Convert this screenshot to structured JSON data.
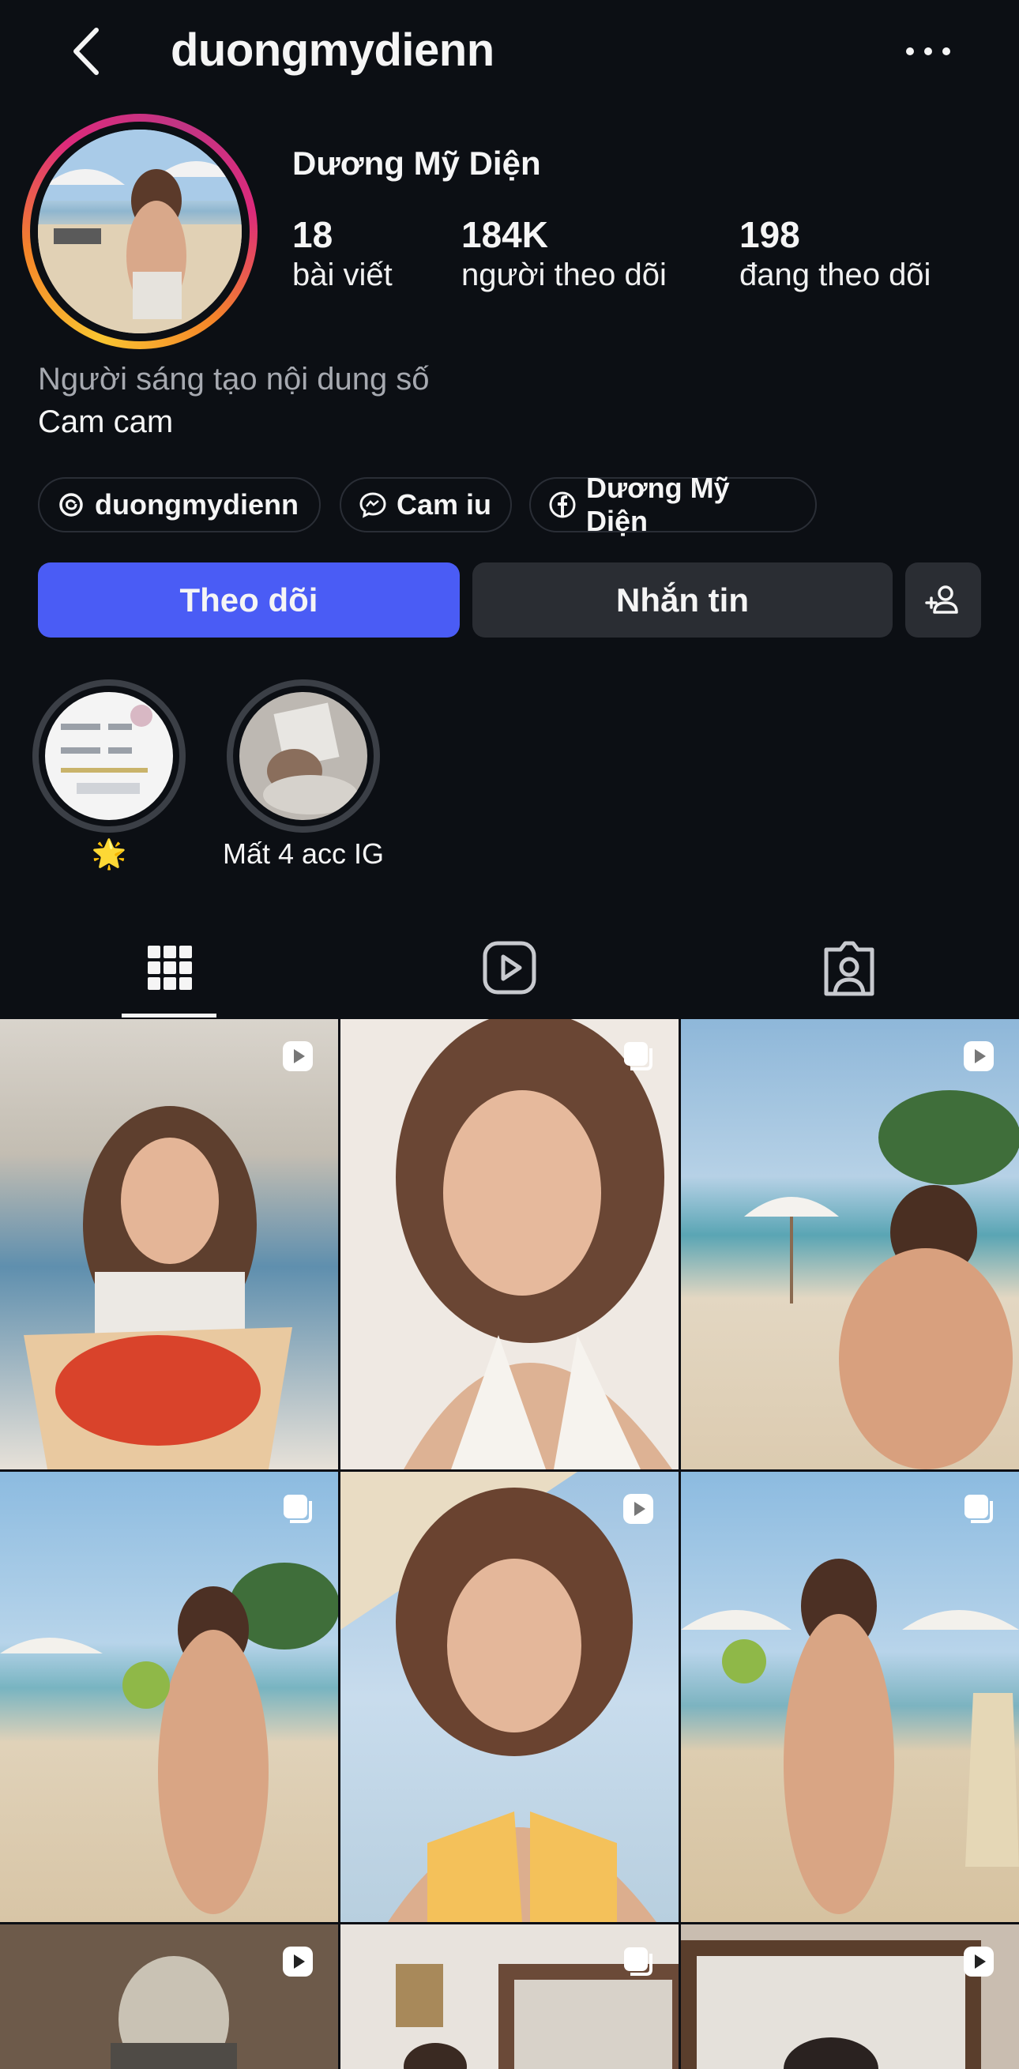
{
  "header": {
    "username": "duongmydienn"
  },
  "profile": {
    "full_name": "Dương Mỹ Diện",
    "stats": [
      {
        "value": "18",
        "label": "bài viết"
      },
      {
        "value": "184K",
        "label": "người theo dõi"
      },
      {
        "value": "198",
        "label": "đang theo dõi"
      }
    ],
    "category": "Người sáng tạo nội dung số",
    "bio": "Cam cam"
  },
  "links": [
    {
      "icon": "threads-icon",
      "label": "duongmydienn"
    },
    {
      "icon": "messenger-icon",
      "label": "Cam iu"
    },
    {
      "icon": "facebook-icon",
      "label": "Dương Mỹ Diện"
    }
  ],
  "actions": {
    "follow_label": "Theo dõi",
    "message_label": "Nhắn tin"
  },
  "highlights": [
    {
      "label": "🌟"
    },
    {
      "label": "Mất 4 acc IG"
    }
  ],
  "tabs": [
    "grid-icon",
    "reels-icon",
    "tagged-icon"
  ],
  "posts": [
    {
      "type": "reel"
    },
    {
      "type": "carousel"
    },
    {
      "type": "reel"
    },
    {
      "type": "carousel"
    },
    {
      "type": "reel"
    },
    {
      "type": "carousel"
    },
    {
      "type": "reel"
    },
    {
      "type": "carousel"
    },
    {
      "type": "reel"
    }
  ],
  "colors": {
    "accent": "#4a5cf5",
    "background": "#0c0f14",
    "button": "#2a2d33"
  }
}
